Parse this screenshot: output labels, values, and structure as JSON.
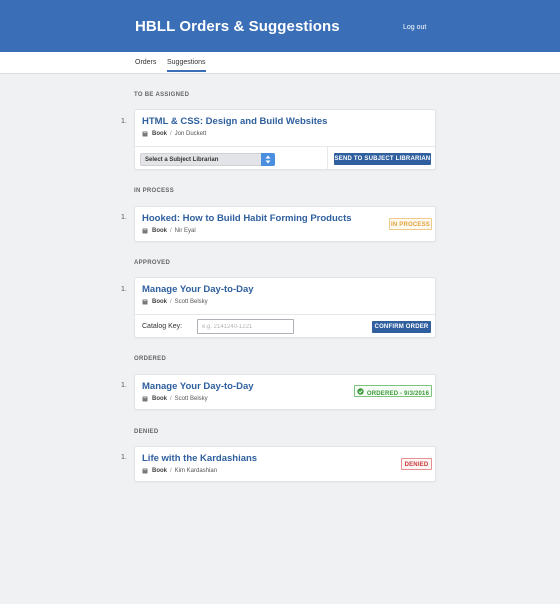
{
  "header": {
    "title": "HBLL Orders & Suggestions",
    "logout_label": "Log out",
    "brand_color": "#3a6fb8"
  },
  "tabs": [
    {
      "label": "Orders",
      "active": false
    },
    {
      "label": "Suggestions",
      "active": true
    }
  ],
  "sections": {
    "to_be_assigned": {
      "label": "TO BE ASSIGNED",
      "items": [
        {
          "number": "1.",
          "title": "HTML & CSS: Design and Build Websites",
          "type": "Book",
          "author": "Jon Duckett",
          "select_value": "Select a Subject Librarian",
          "button_label": "SEND TO SUBJECT LIBRARIAN"
        }
      ]
    },
    "in_process": {
      "label": "IN PROCESS",
      "items": [
        {
          "number": "1.",
          "title": "Hooked: How to Build Habit Forming Products",
          "type": "Book",
          "author": "Nir Eyal",
          "status": "IN PROCESS"
        }
      ]
    },
    "approved": {
      "label": "APPROVED",
      "items": [
        {
          "number": "1.",
          "title": "Manage Your Day-to-Day",
          "type": "Book",
          "author": "Scott Belsky",
          "catalog_label": "Catalog Key:",
          "catalog_placeholder": "e.g. 2141240-1221",
          "catalog_value": "",
          "button_label": "CONFIRM ORDER"
        }
      ]
    },
    "ordered": {
      "label": "ORDERED",
      "items": [
        {
          "number": "1.",
          "title": "Manage Your Day-to-Day",
          "type": "Book",
          "author": "Scott Belsky",
          "status": "ORDERED - 9/3/2016"
        }
      ]
    },
    "denied": {
      "label": "DENIED",
      "items": [
        {
          "number": "1.",
          "title": "Life with the Kardashians",
          "type": "Book",
          "author": "Kim Kardashian",
          "status": "DENIED"
        }
      ]
    }
  },
  "icons": {
    "item_type": "book-icon",
    "select_caret": "sort-caret-icon",
    "ordered_status": "check-circle-icon"
  },
  "colors": {
    "link": "#2e5f9e",
    "button": "#2f5f9f",
    "in_process": "#e0a23a",
    "ordered": "#3a9a3a",
    "denied": "#c43a3a"
  }
}
